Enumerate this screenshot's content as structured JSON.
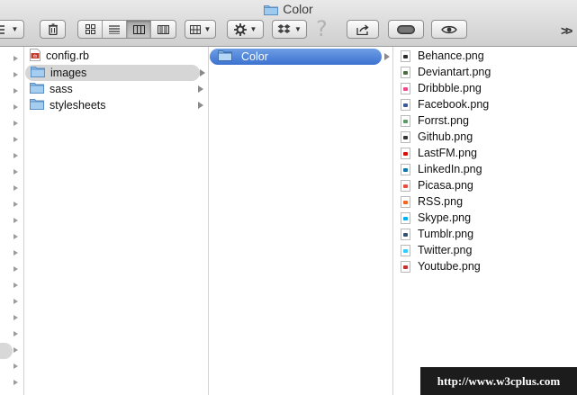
{
  "window": {
    "title": "Color"
  },
  "toolbar": {
    "buttons": [
      {
        "name": "delete",
        "icon": "trash-icon"
      },
      {
        "name": "view-icon-mode",
        "icon": "grid-icon"
      },
      {
        "name": "view-list-mode",
        "icon": "list-icon"
      },
      {
        "name": "view-column-mode",
        "icon": "columns-icon",
        "active": true
      },
      {
        "name": "view-coverflow-mode",
        "icon": "coverflow-icon"
      },
      {
        "name": "arrange",
        "icon": "arrange-icon"
      },
      {
        "name": "action",
        "icon": "gear-icon"
      },
      {
        "name": "dropbox",
        "icon": "dropbox-icon"
      },
      {
        "name": "help",
        "icon": "question-icon",
        "label": "?"
      },
      {
        "name": "share",
        "icon": "share-icon"
      },
      {
        "name": "tags",
        "icon": "toggle-icon"
      },
      {
        "name": "quick-look",
        "icon": "eye-icon"
      }
    ],
    "overflow_label": ">>"
  },
  "column1": {
    "items": [
      {
        "name": "config.rb",
        "kind": "file",
        "icon": "ruby-file-icon"
      },
      {
        "name": "images",
        "kind": "folder",
        "selected": true
      },
      {
        "name": "sass",
        "kind": "folder"
      },
      {
        "name": "stylesheets",
        "kind": "folder"
      }
    ]
  },
  "column2": {
    "items": [
      {
        "name": "Color",
        "kind": "folder",
        "selected": true
      }
    ]
  },
  "column3": {
    "items": [
      {
        "name": "Behance.png",
        "accent": "#2b2b2b"
      },
      {
        "name": "Deviantart.png",
        "accent": "#4d6b41"
      },
      {
        "name": "Dribbble.png",
        "accent": "#ea4c89"
      },
      {
        "name": "Facebook.png",
        "accent": "#3b5998"
      },
      {
        "name": "Forrst.png",
        "accent": "#5b9a68"
      },
      {
        "name": "Github.png",
        "accent": "#333333"
      },
      {
        "name": "LastFM.png",
        "accent": "#d51007"
      },
      {
        "name": "LinkedIn.png",
        "accent": "#0e76a8"
      },
      {
        "name": "Picasa.png",
        "accent": "#e74c3c"
      },
      {
        "name": "RSS.png",
        "accent": "#f26522"
      },
      {
        "name": "Skype.png",
        "accent": "#00aff0"
      },
      {
        "name": "Tumblr.png",
        "accent": "#34526f"
      },
      {
        "name": "Twitter.png",
        "accent": "#33ccff"
      },
      {
        "name": "Youtube.png",
        "accent": "#c4302b"
      }
    ]
  },
  "watermark": {
    "text": "http://www.w3cplus.com"
  },
  "colors": {
    "selection_blue": "#3c72d0",
    "selection_gray": "#d6d6d6",
    "folder_blue": "#7fb2e0"
  }
}
